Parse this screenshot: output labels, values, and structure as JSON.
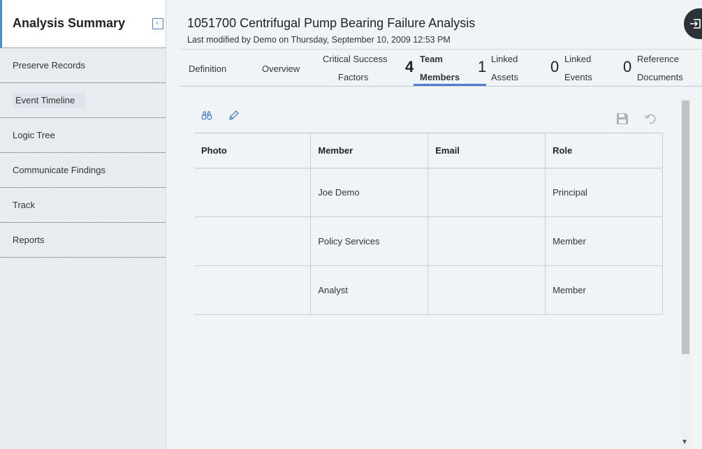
{
  "sidebar": {
    "title": "Analysis Summary",
    "collapse_glyph": "‹",
    "items": [
      {
        "label": "Preserve Records"
      },
      {
        "label": "Event Timeline"
      },
      {
        "label": "Logic Tree"
      },
      {
        "label": "Communicate Findings"
      },
      {
        "label": "Track"
      },
      {
        "label": "Reports"
      }
    ]
  },
  "header": {
    "title": "1051700 Centrifugal Pump Bearing Failure Analysis",
    "subtitle": "Last modified by Demo on Thursday, September 10, 2009 12:53 PM"
  },
  "tabs": [
    {
      "label": "Definition"
    },
    {
      "label": "Overview"
    },
    {
      "line1": "Critical Success",
      "line2": "Factors"
    },
    {
      "count": "4",
      "line1": "Team",
      "line2": "Members"
    },
    {
      "count": "1",
      "line1": "Linked",
      "line2": "Assets"
    },
    {
      "count": "0",
      "line1": "Linked",
      "line2": "Events"
    },
    {
      "count": "0",
      "line1": "Reference",
      "line2": "Documents"
    }
  ],
  "toolbar": {
    "icons": [
      "binoculars-icon",
      "pencil-icon",
      "save-icon",
      "undo-icon"
    ]
  },
  "table": {
    "columns": [
      "Photo",
      "Member",
      "Email",
      "Role"
    ],
    "rows": [
      {
        "photo": "",
        "member": "Joe Demo",
        "email": "",
        "role": "Principal"
      },
      {
        "photo": "",
        "member": "Policy Services",
        "email": "",
        "role": "Member"
      },
      {
        "photo": "",
        "member": "Analyst",
        "email": "",
        "role": "Member"
      }
    ]
  },
  "colors": {
    "accent": "#4a80cf",
    "sidebar_bg": "#e8ecf0",
    "main_bg": "#f1f4f7",
    "fab_bg": "#2a3138"
  }
}
